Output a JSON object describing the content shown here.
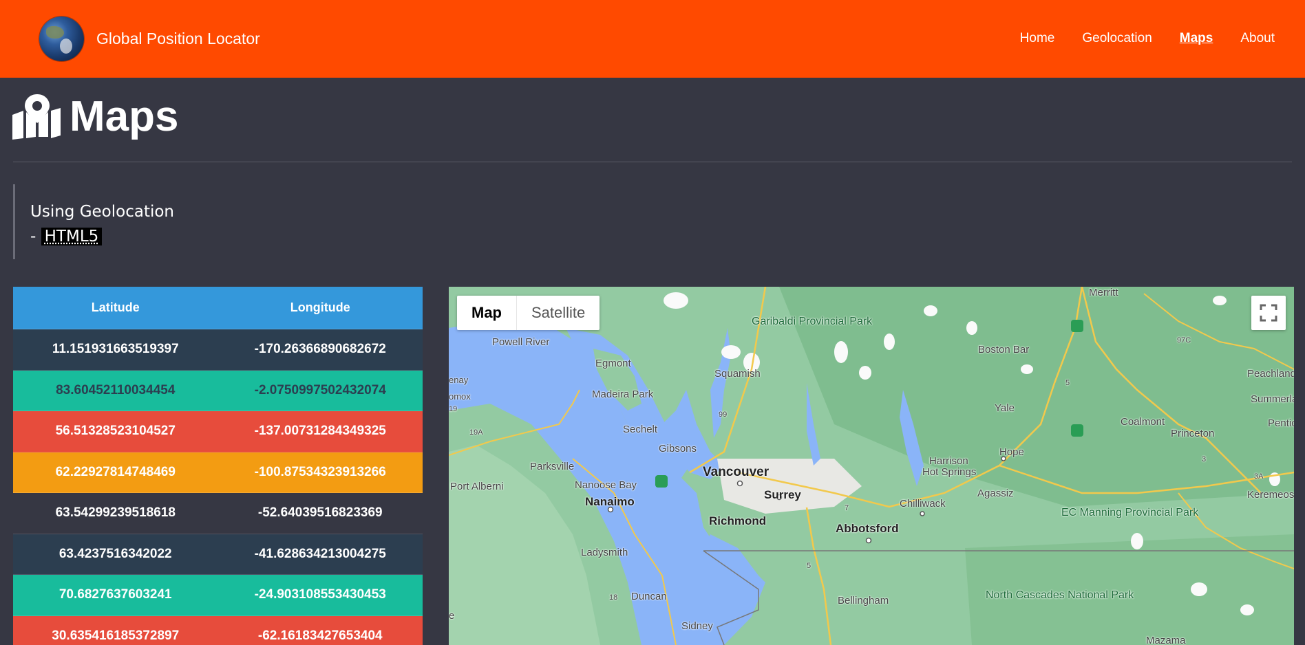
{
  "navbar": {
    "brand": "Global Position Locator",
    "links": [
      "Home",
      "Geolocation",
      "Maps",
      "About"
    ],
    "active": "Maps"
  },
  "header": {
    "title": "Maps"
  },
  "quote": {
    "line1": "Using Geolocation",
    "prefix": "- ",
    "abbr": "HTML5"
  },
  "table": {
    "columns": [
      "Latitude",
      "Longitude"
    ],
    "rows": [
      [
        "11.151931663519397",
        "-170.26366890682672"
      ],
      [
        "83.60452110034454",
        "-2.0750997502432074"
      ],
      [
        "56.51328523104527",
        "-137.00731284349325"
      ],
      [
        "62.22927814748469",
        "-100.87534323913266"
      ],
      [
        "63.54299239518618",
        "-52.64039516823369"
      ],
      [
        "63.4237516342022",
        "-41.628634213004275"
      ],
      [
        "70.6827637603241",
        "-24.903108553430453"
      ],
      [
        "30.635416185372897",
        "-62.16183427653404"
      ]
    ]
  },
  "map": {
    "type_buttons": [
      "Map",
      "Satellite"
    ],
    "selected_type": "Map",
    "labels": {
      "powell_river": "Powell River",
      "egmont": "Egmont",
      "madeira_park": "Madeira Park",
      "sechelt": "Sechelt",
      "gibsons": "Gibsons",
      "parksville": "Parksville",
      "nanoose_bay": "Nanoose Bay",
      "port_alberni": "Port Alberni",
      "nanaimo": "Nanaimo",
      "ladysmith": "Ladysmith",
      "duncan": "Duncan",
      "sidney": "Sidney",
      "squamish": "Squamish",
      "vancouver": "Vancouver",
      "surrey": "Surrey",
      "richmond": "Richmond",
      "abbotsford": "Abbotsford",
      "bellingham": "Bellingham",
      "chilliwack": "Chilliwack",
      "harrison": "Harrison",
      "hot_springs": "Hot Springs",
      "agassiz": "Agassiz",
      "hope": "Hope",
      "yale": "Yale",
      "boston_bar": "Boston Bar",
      "merritt": "Merritt",
      "coalmont": "Coalmont",
      "princeton": "Princeton",
      "keremeos": "Keremeos",
      "peachland": "Peachland",
      "summerland": "Summerla",
      "pentict": "Pentic",
      "mazama": "Mazama",
      "garibaldi": "Garibaldi Provincial Park",
      "ec_manning": "EC Manning Provincial Park",
      "north_cascades": "North Cascades National Park",
      "enay": "enay",
      "omox": "omox",
      "e": "e",
      "r19": "19",
      "r19a": "19A",
      "r99": "99",
      "r5": "5",
      "r3": "3",
      "r3a": "3A",
      "r97c": "97C",
      "r7": "7",
      "r18": "18",
      "i5": "5"
    }
  },
  "colors": {
    "navbar": "#ff4a00",
    "page_bg": "#363743",
    "table_head": "#3498db",
    "row_dark": "#2c3e50",
    "row_teal": "#18bc9c",
    "row_red": "#e74c3c",
    "row_orange": "#f39c12"
  }
}
